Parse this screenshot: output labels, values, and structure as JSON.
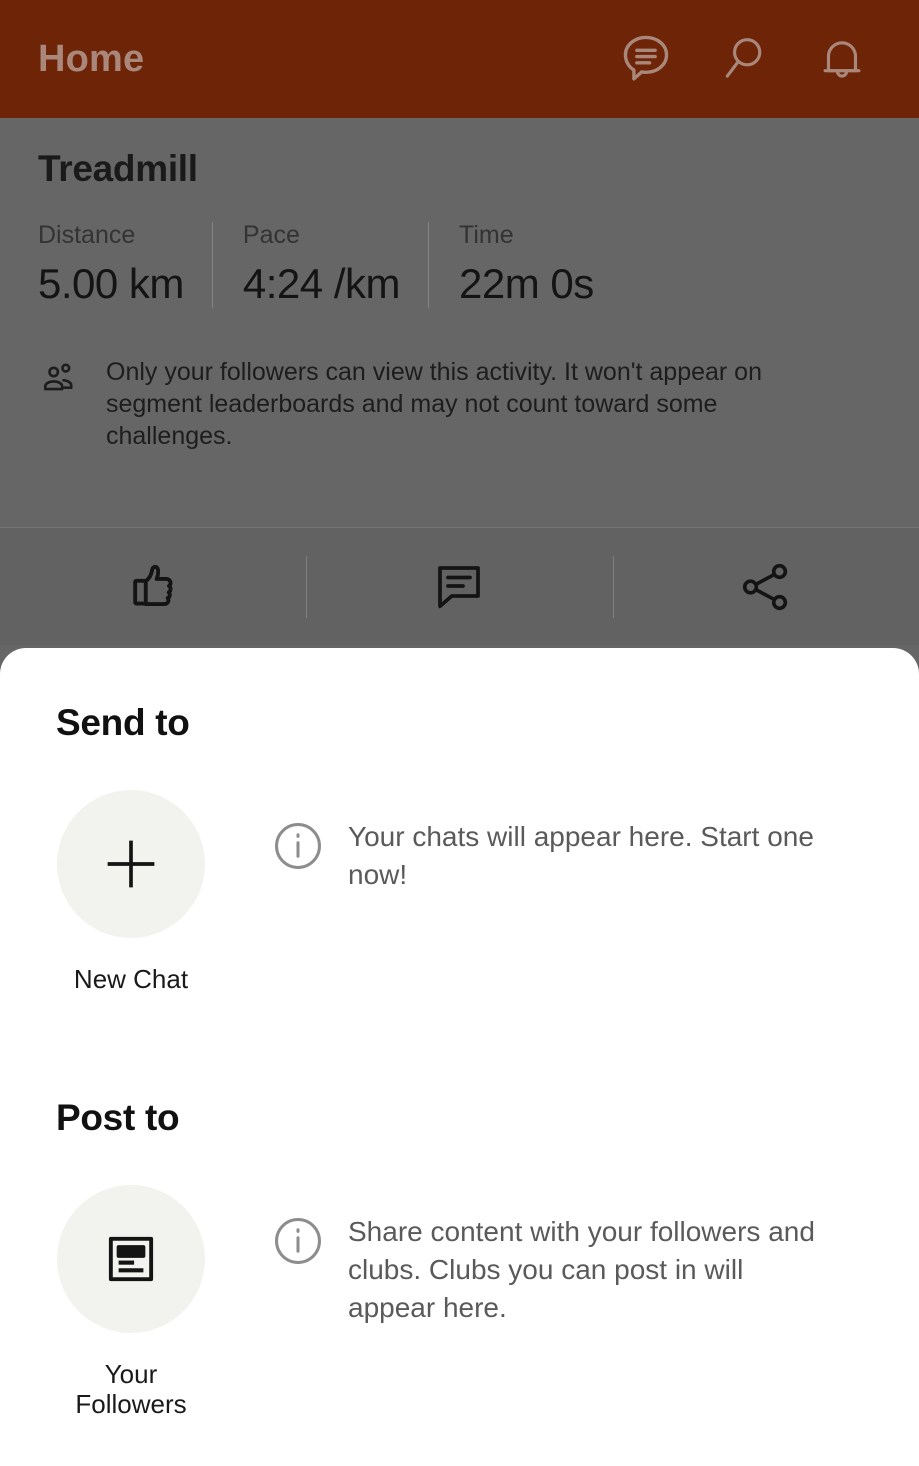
{
  "colors": {
    "header_bg": "#6d2407",
    "header_title": "#a9887b",
    "dim_overlay": "#666666",
    "sheet_bg": "#ffffff",
    "tile_circle": "#f2f2ee",
    "muted_text": "#5a5a5a"
  },
  "header": {
    "title": "Home",
    "icons": [
      {
        "name": "chat-icon"
      },
      {
        "name": "search-icon"
      },
      {
        "name": "notifications-bell-icon"
      }
    ]
  },
  "activity": {
    "title": "Treadmill",
    "stats": [
      {
        "label": "Distance",
        "value": "5.00 km"
      },
      {
        "label": "Pace",
        "value": "4:24 /km"
      },
      {
        "label": "Time",
        "value": "22m 0s"
      }
    ],
    "privacy": {
      "icon": "followers-icon",
      "text": "Only your followers can view this activity. It won't appear on segment leaderboards and may not count toward some challenges."
    },
    "actions": [
      {
        "name": "like-button",
        "icon": "thumbs-up-icon"
      },
      {
        "name": "comment-button",
        "icon": "comment-icon"
      },
      {
        "name": "share-button",
        "icon": "share-icon"
      }
    ]
  },
  "sheet": {
    "send_to": {
      "heading": "Send to",
      "tile": {
        "icon": "plus-icon",
        "label": "New Chat"
      },
      "empty_state": {
        "icon": "info-icon",
        "text": "Your chats will appear here. Start one now!"
      }
    },
    "post_to": {
      "heading": "Post to",
      "tile": {
        "icon": "feed-post-icon",
        "label": "Your Followers"
      },
      "empty_state": {
        "icon": "info-icon",
        "text": "Share content with your followers and clubs. Clubs you can post in will appear here."
      }
    }
  }
}
